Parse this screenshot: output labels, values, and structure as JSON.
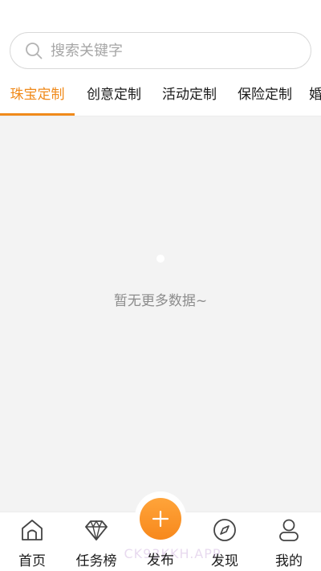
{
  "search": {
    "placeholder": "搜索关键字",
    "value": ""
  },
  "tabs": [
    {
      "label": "珠宝定制",
      "active": true
    },
    {
      "label": "创意定制",
      "active": false
    },
    {
      "label": "活动定制",
      "active": false
    },
    {
      "label": "保险定制",
      "active": false
    },
    {
      "label": "婚",
      "active": false
    }
  ],
  "empty_state": {
    "message": "暂无更多数据~"
  },
  "bottom_nav": [
    {
      "label": "首页",
      "icon": "home-icon"
    },
    {
      "label": "任务榜",
      "icon": "diamond-icon"
    },
    {
      "label": "发布",
      "icon": "plus-icon"
    },
    {
      "label": "发现",
      "icon": "compass-icon"
    },
    {
      "label": "我的",
      "icon": "user-icon"
    }
  ],
  "watermark": "CK93KKH.APP",
  "colors": {
    "accent": "#f08a1a",
    "background": "#f3f3f3",
    "text": "#1a1a1a",
    "muted": "#8c8c8c"
  }
}
